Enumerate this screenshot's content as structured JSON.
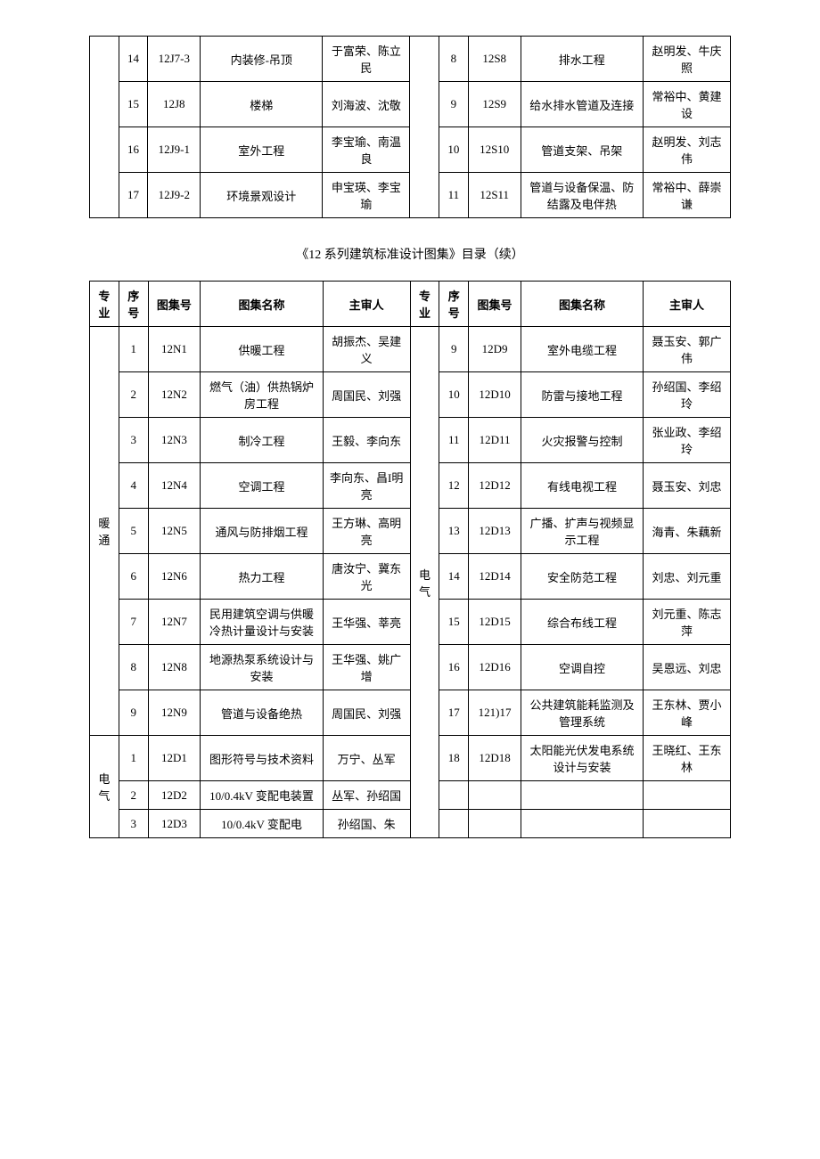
{
  "topTable": {
    "leftRows": [
      {
        "seq": "14",
        "code": "12J7-3",
        "name": "内装修-吊顶",
        "reviewer": "于富荣、陈立民"
      },
      {
        "seq": "15",
        "code": "12J8",
        "name": "楼梯",
        "reviewer": "刘海波、沈敬"
      },
      {
        "seq": "16",
        "code": "12J9-1",
        "name": "室外工程",
        "reviewer": "李宝瑜、南温良"
      },
      {
        "seq": "17",
        "code": "12J9-2",
        "name": "环境景观设计",
        "reviewer": "申宝瑛、李宝瑜"
      }
    ],
    "rightRows": [
      {
        "seq": "8",
        "code": "12S8",
        "name": "排水工程",
        "reviewer": "赵明发、牛庆照"
      },
      {
        "seq": "9",
        "code": "12S9",
        "name": "给水排水管道及连接",
        "reviewer": "常裕中、黄建设"
      },
      {
        "seq": "10",
        "code": "12S10",
        "name": "管道支架、吊架",
        "reviewer": "赵明发、刘志伟"
      },
      {
        "seq": "11",
        "code": "12S11",
        "name": "管道与设备保温、防结露及电伴热",
        "reviewer": "常裕中、薛崇谦"
      }
    ]
  },
  "sectionTitle": "《12 系列建筑标准设计图集》目录（续）",
  "headers": {
    "specialty": "专业",
    "seq": "序号",
    "code": "图集号",
    "name": "图集名称",
    "reviewer": "主审人"
  },
  "bottomTable": {
    "leftGroups": [
      {
        "specialty": "暖通",
        "rows": [
          {
            "seq": "1",
            "code": "12N1",
            "name": "供暖工程",
            "reviewer": "胡振杰、吴建义"
          },
          {
            "seq": "2",
            "code": "12N2",
            "name": "燃气（油）供热锅炉房工程",
            "reviewer": "周国民、刘强"
          },
          {
            "seq": "3",
            "code": "12N3",
            "name": "制冷工程",
            "reviewer": "王毅、李向东"
          },
          {
            "seq": "4",
            "code": "12N4",
            "name": "空调工程",
            "reviewer": "李向东、昌I明亮"
          },
          {
            "seq": "5",
            "code": "12N5",
            "name": "通风与防排烟工程",
            "reviewer": "王方琳、高明亮"
          },
          {
            "seq": "6",
            "code": "12N6",
            "name": "热力工程",
            "reviewer": "唐汝宁、冀东光"
          },
          {
            "seq": "7",
            "code": "12N7",
            "name": "民用建筑空调与供暖冷热计量设计与安装",
            "reviewer": "王华强、莘亮"
          },
          {
            "seq": "8",
            "code": "12N8",
            "name": "地源热泵系统设计与安装",
            "reviewer": "王华强、姚广增"
          },
          {
            "seq": "9",
            "code": "12N9",
            "name": "管道与设备绝热",
            "reviewer": "周国民、刘强"
          }
        ]
      },
      {
        "specialty": "电气",
        "rows": [
          {
            "seq": "1",
            "code": "12D1",
            "name": "图形符号与技术资料",
            "reviewer": "万宁、丛军"
          },
          {
            "seq": "2",
            "code": "12D2",
            "name": "10/0.4kV 变配电装置",
            "reviewer": "丛军、孙绍国"
          },
          {
            "seq": "3",
            "code": "12D3",
            "name": "10/0.4kV 变配电",
            "reviewer": "孙绍国、朱"
          }
        ]
      }
    ],
    "rightGroups": [
      {
        "specialty": "电气",
        "rows": [
          {
            "seq": "9",
            "code": "12D9",
            "name": "室外电缆工程",
            "reviewer": "聂玉安、郭广伟"
          },
          {
            "seq": "10",
            "code": "12D10",
            "name": "防雷与接地工程",
            "reviewer": "孙绍国、李绍玲"
          },
          {
            "seq": "11",
            "code": "12D11",
            "name": "火灾报警与控制",
            "reviewer": "张业政、李绍玲"
          },
          {
            "seq": "12",
            "code": "12D12",
            "name": "有线电视工程",
            "reviewer": "聂玉安、刘忠"
          },
          {
            "seq": "13",
            "code": "12D13",
            "name": "广播、扩声与视频显示工程",
            "reviewer": "海青、朱藕新"
          },
          {
            "seq": "14",
            "code": "12D14",
            "name": "安全防范工程",
            "reviewer": "刘忠、刘元重"
          },
          {
            "seq": "15",
            "code": "12D15",
            "name": "综合布线工程",
            "reviewer": "刘元重、陈志萍"
          },
          {
            "seq": "16",
            "code": "12D16",
            "name": "空调自控",
            "reviewer": "吴恩远、刘忠"
          },
          {
            "seq": "17",
            "code": "121)17",
            "name": "公共建筑能耗监测及管理系统",
            "reviewer": "王东林、贾小峰"
          },
          {
            "seq": "18",
            "code": "12D18",
            "name": "太阳能光伏发电系统设计与安装",
            "reviewer": "王晓红、王东林"
          }
        ]
      }
    ],
    "rightEmptyRows": 2
  }
}
